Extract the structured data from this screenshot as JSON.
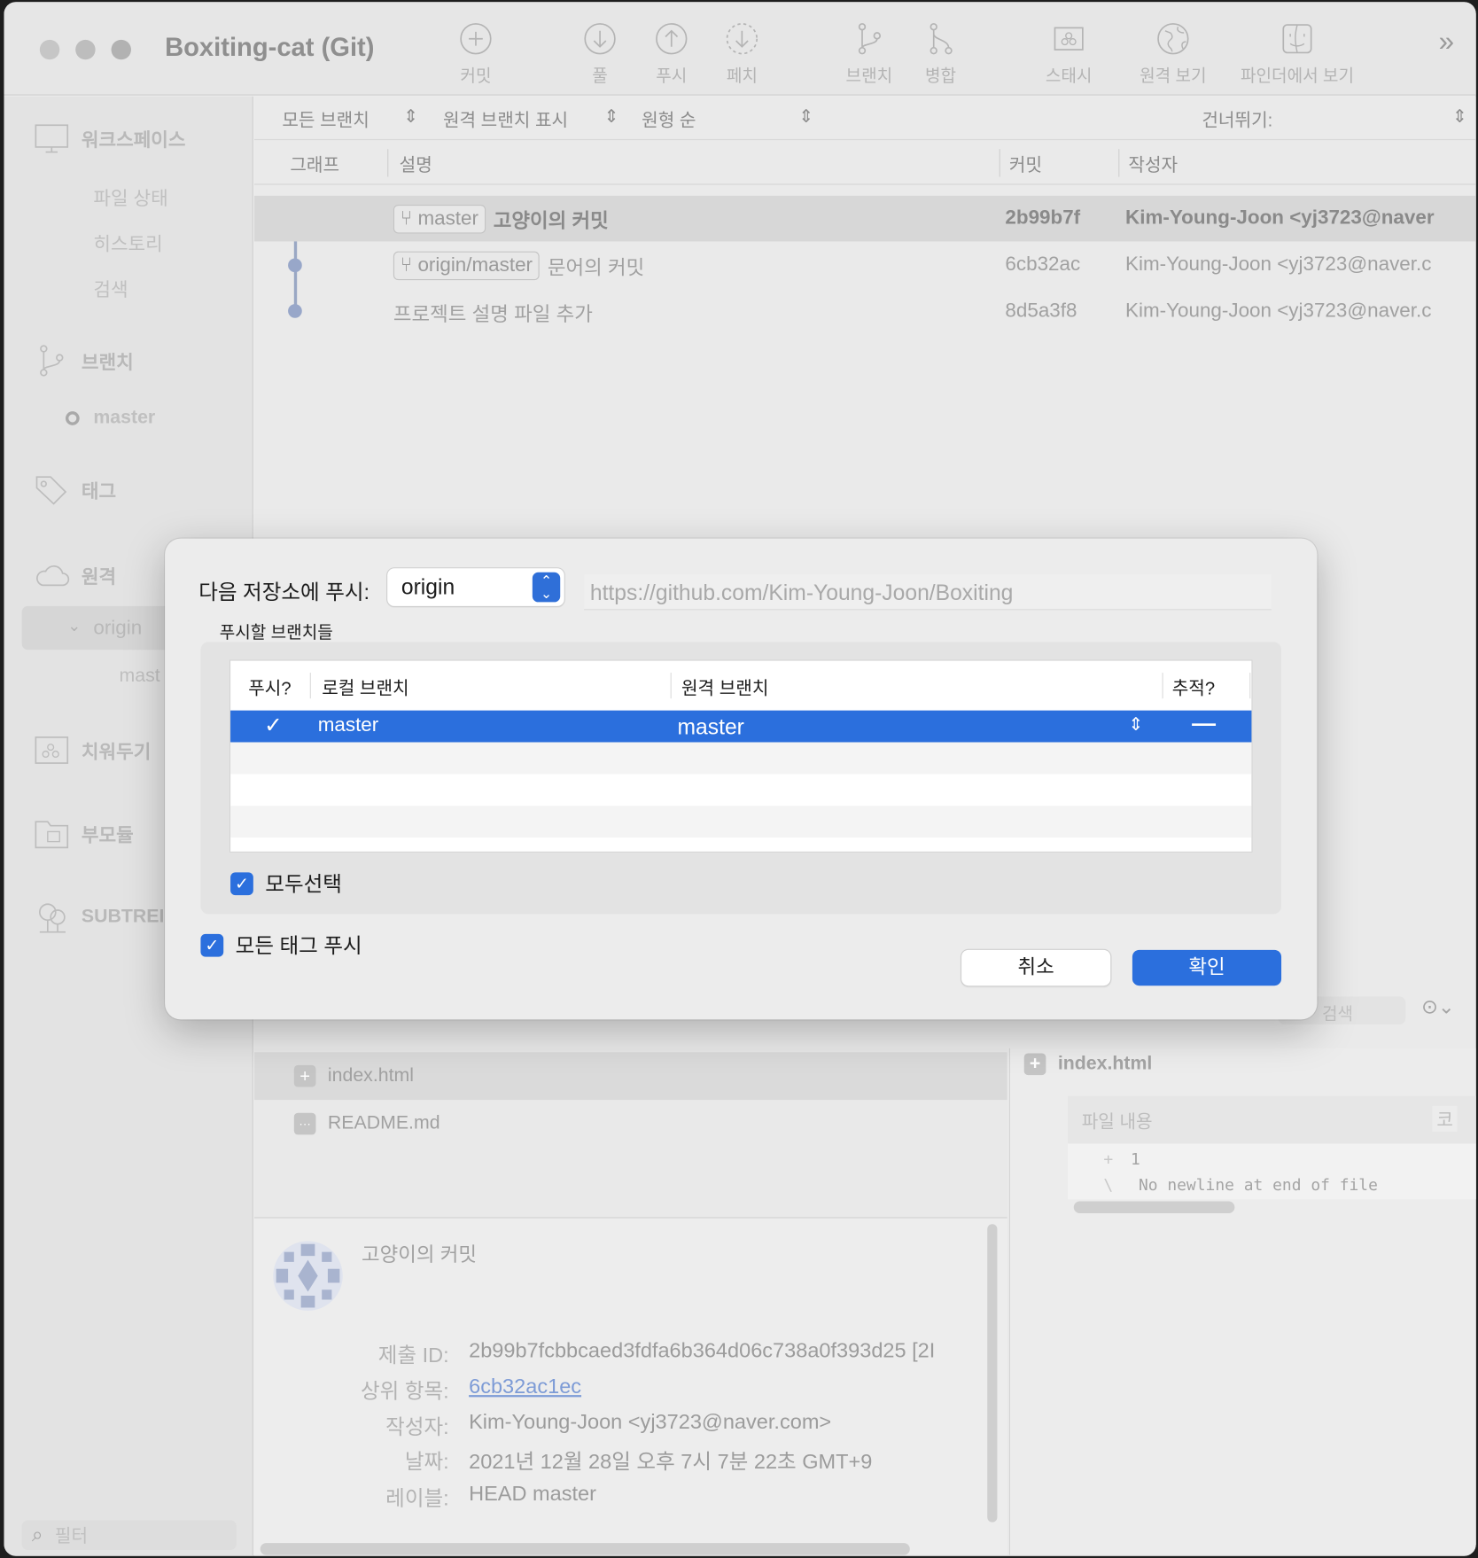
{
  "window": {
    "title": "Boxiting-cat (Git)"
  },
  "toolbar": {
    "buttons": [
      {
        "label": "커밋",
        "icon": "plus-circle-icon"
      },
      {
        "label": "풀",
        "icon": "arrow-down-circle-icon"
      },
      {
        "label": "푸시",
        "icon": "arrow-up-circle-icon"
      },
      {
        "label": "페치",
        "icon": "dashed-arrow-down-circle-icon"
      },
      {
        "label": "브랜치",
        "icon": "branch-icon"
      },
      {
        "label": "병합",
        "icon": "merge-icon"
      },
      {
        "label": "스태시",
        "icon": "stash-icon"
      },
      {
        "label": "원격 보기",
        "icon": "globe-icon"
      },
      {
        "label": "파인더에서 보기",
        "icon": "finder-icon"
      }
    ],
    "more": "»"
  },
  "sidebar": {
    "workspace": "워크스페이스",
    "file_status": "파일 상태",
    "history": "히스토리",
    "search": "검색",
    "branches": "브랜치",
    "branch_master": "master",
    "tags": "태그",
    "remotes": "원격",
    "remote_origin": "origin",
    "remote_origin_master": "mast",
    "stashes": "치워두기",
    "submodules": "부모듈",
    "subtrees": "SUBTREI",
    "filter_placeholder": "필터"
  },
  "filterbar": {
    "branches": "모든 브랜치",
    "show_remote": "원격 브랜치 표시",
    "order": "원형 순",
    "skip": "건너뛰기:"
  },
  "columns": {
    "graph": "그래프",
    "description": "설명",
    "commit": "커밋",
    "author": "작성자"
  },
  "commits": [
    {
      "tag": "master",
      "message": "고양이의 커밋",
      "hash": "2b99b7f",
      "author": "Kim-Young-Joon <yj3723@naver"
    },
    {
      "tag": "origin/master",
      "message": "문어의 커밋",
      "hash": "6cb32ac",
      "author": "Kim-Young-Joon <yj3723@naver.c"
    },
    {
      "tag": "",
      "message": "프로젝트 설명 파일 추가",
      "hash": "8d5a3f8",
      "author": "Kim-Young-Joon <yj3723@naver.c"
    }
  ],
  "files": [
    {
      "name": "index.html",
      "icon": "plus-square-icon"
    },
    {
      "name": "README.md",
      "icon": "ellipsis-square-icon"
    }
  ],
  "details": {
    "title": "고양이의 커밋",
    "commit_id_label": "제출 ID:",
    "commit_id": "2b99b7fcbbcaed3fdfa6b364d06c738a0f393d25 [2I",
    "parent_label": "상위 항목:",
    "parent": "6cb32ac1ec",
    "author_label": "작성자:",
    "author": "Kim-Young-Joon <yj3723@naver.com>",
    "date_label": "날짜:",
    "date": "2021년 12월 28일 오후 7시 7분 22초 GMT+9",
    "labels_label": "레이블:",
    "labels": "HEAD master"
  },
  "diff": {
    "search_placeholder": "검색",
    "file": "index.html",
    "file_content_label": "파일 내용",
    "code_label": "코",
    "line1_marker": "+",
    "line1": "1",
    "line2_marker": "\\",
    "line2": "No newline at end of file"
  },
  "push_dialog": {
    "push_to_label": "다음 저장소에 푸시:",
    "remote": "origin",
    "url": "https://github.com/Kim-Young-Joon/Boxiting",
    "branches_label": "푸시할 브랜치들",
    "col_push": "푸시?",
    "col_local": "로컬 브랜치",
    "col_remote": "원격 브랜치",
    "col_track": "추적?",
    "rows": [
      {
        "push": "✓",
        "local": "master",
        "remote": "master",
        "track": "—"
      }
    ],
    "select_all": "모두선택",
    "push_all_tags": "모든 태그 푸시",
    "cancel": "취소",
    "ok": "확인"
  }
}
